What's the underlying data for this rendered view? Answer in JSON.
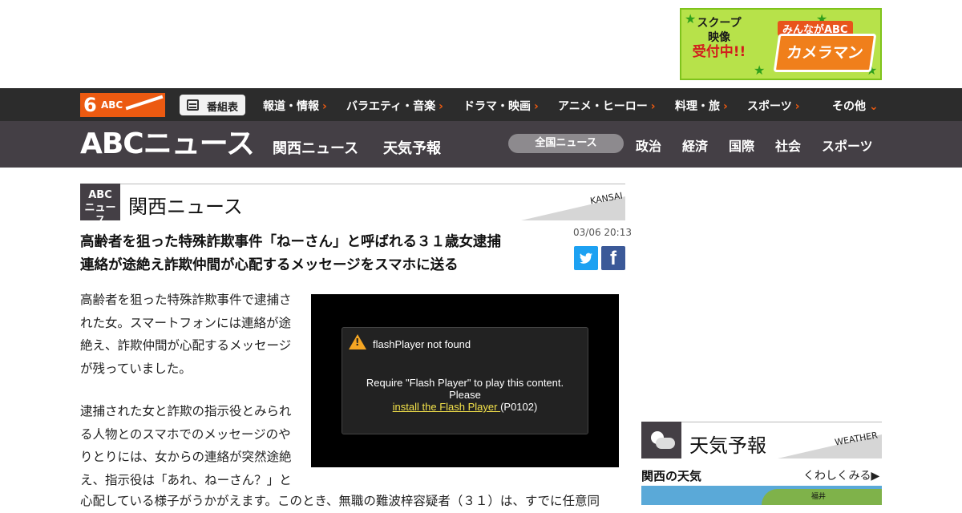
{
  "ad": {
    "scoop_line1": "スクープ",
    "scoop_line2": "映像",
    "scoop_line3": "受付中!!",
    "brand_top": "みんながABC",
    "brand_main": "カメラマン"
  },
  "topnav": {
    "logo_number": "6",
    "logo_text": "ABC",
    "bangumi_label": "番組表",
    "items": [
      {
        "label": "報道・情報"
      },
      {
        "label": "バラエティ・音楽"
      },
      {
        "label": "ドラマ・映画"
      },
      {
        "label": "アニメ・ヒーロー"
      },
      {
        "label": "料理・旅"
      },
      {
        "label": "スポーツ"
      },
      {
        "label": "その他"
      }
    ]
  },
  "subhead": {
    "logo": "ABCニュース",
    "links": [
      {
        "label": "関西ニュース"
      },
      {
        "label": "天気予報"
      }
    ],
    "zenkoku_label": "全国ニュース",
    "categories": [
      {
        "label": "政治"
      },
      {
        "label": "経済"
      },
      {
        "label": "国際"
      },
      {
        "label": "社会"
      },
      {
        "label": "スポーツ"
      }
    ]
  },
  "section": {
    "logo_line1": "ABC",
    "logo_line2": "ニュース",
    "title": "関西ニュース",
    "en_label": "KANSAI"
  },
  "article": {
    "headline_line1": "高齢者を狙った特殊詐欺事件「ねーさん」と呼ばれる３１歳女逮捕",
    "headline_line2": "連絡が途絶え詐欺仲間が心配するメッセージをスマホに送る",
    "date": "03/06 20:13",
    "facebook_glyph": "f",
    "para1": "高齢者を狙った特殊詐欺事件で逮捕された女。スマートフォンには連絡が途絶え、詐欺仲間が心配するメッセージが残っていました。",
    "para2": "逮捕された女と詐欺の指示役とみられる人物とのスマホでのメッセージのやりとりには、女からの連絡が突然途絶え、指示役は「あれ、ねーさん？」と",
    "para3": "心配している様子がうかがえます。このとき、無職の難波梓容疑者（３１）は、すでに任意同"
  },
  "player": {
    "title": "flashPlayer not found",
    "msg_line1": "Require \"Flash Player\" to play this content.",
    "msg_line2": "Please",
    "link_text": "install the Flash Player ",
    "code": "(P0102)"
  },
  "weather": {
    "title": "天気予報",
    "en_label": "WEATHER",
    "kansai_label": "関西の天気",
    "more_label": "くわしくみる▶",
    "map_city": "福井"
  }
}
